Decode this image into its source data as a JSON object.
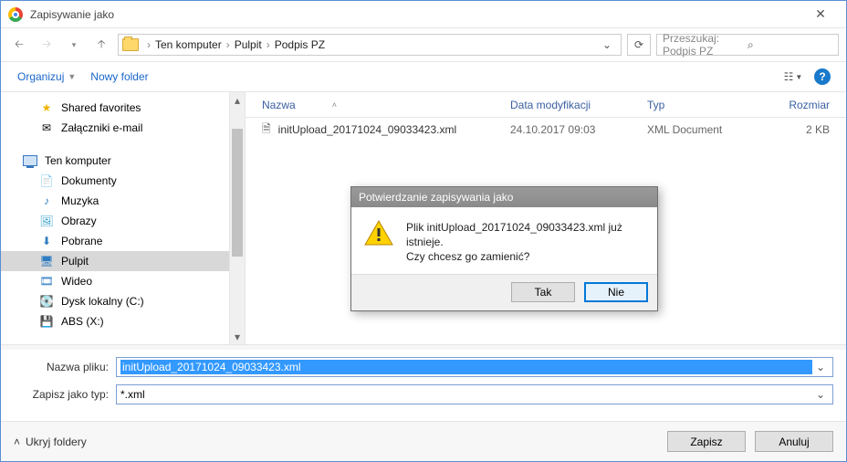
{
  "title": "Zapisywanie jako",
  "breadcrumb": {
    "root": "Ten komputer",
    "items": [
      "Pulpit",
      "Podpis PZ"
    ]
  },
  "search": {
    "placeholder": "Przeszukaj: Podpis PZ"
  },
  "toolbar": {
    "organize": "Organizuj",
    "newfolder": "Nowy folder"
  },
  "columns": {
    "name": "Nazwa",
    "date": "Data modyfikacji",
    "type": "Typ",
    "size": "Rozmiar"
  },
  "tree": {
    "shared": "Shared favorites",
    "attachments": "Załączniki e-mail",
    "thispc": "Ten komputer",
    "documents": "Dokumenty",
    "music": "Muzyka",
    "pictures": "Obrazy",
    "downloads": "Pobrane",
    "desktop": "Pulpit",
    "videos": "Wideo",
    "localdisk": "Dysk lokalny (C:)",
    "abs": "ABS (X:)"
  },
  "file": {
    "name": "initUpload_20171024_09033423.xml",
    "date": "24.10.2017 09:03",
    "type": "XML Document",
    "size": "2 KB"
  },
  "form": {
    "filename_label": "Nazwa pliku:",
    "filetype_label": "Zapisz jako typ:",
    "filename_value": "initUpload_20171024_09033423.xml",
    "filetype_value": "*.xml"
  },
  "footer": {
    "hide": "Ukryj foldery",
    "save": "Zapisz",
    "cancel": "Anuluj"
  },
  "modal": {
    "title": "Potwierdzanie zapisywania jako",
    "line1": "Plik initUpload_20171024_09033423.xml już istnieje.",
    "line2": "Czy chcesz go zamienić?",
    "yes": "Tak",
    "no": "Nie"
  }
}
